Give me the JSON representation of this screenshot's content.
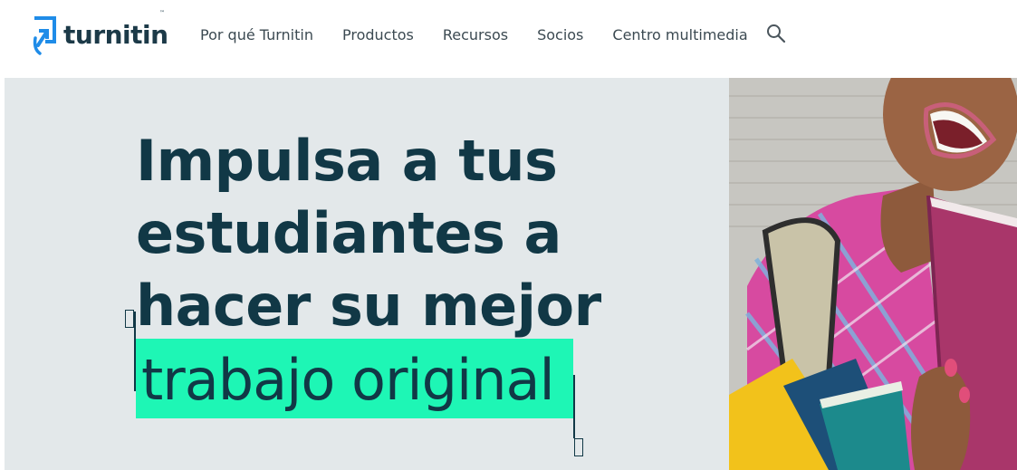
{
  "brand": {
    "name": "turnitin",
    "trademark": "™"
  },
  "nav": {
    "items": [
      {
        "label": "Por qué Turnitin"
      },
      {
        "label": "Productos"
      },
      {
        "label": "Recursos"
      },
      {
        "label": "Socios"
      },
      {
        "label": "Centro multimedia"
      }
    ],
    "search_icon": "search-icon"
  },
  "hero": {
    "headline_lines": [
      "Impulsa a tus",
      "estudiantes a",
      "hacer su mejor"
    ],
    "highlight": "trabajo original",
    "image": "student-laughing-with-books-photo"
  },
  "colors": {
    "brand_dark": "#113846",
    "brand_blue": "#1f8ce8",
    "highlight_green": "#1ef6b5",
    "hero_bg": "#e3e8ea",
    "nav_text": "#3c4a52"
  }
}
